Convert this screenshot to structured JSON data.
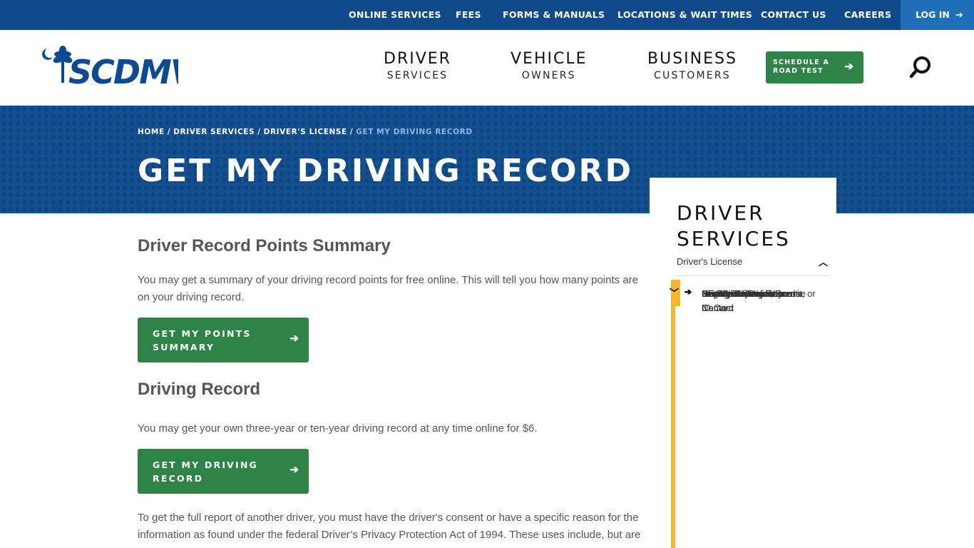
{
  "topbar": {
    "links": [
      "ONLINE SERVICES",
      "FEES",
      "FORMS & MANUALS",
      "LOCATIONS & WAIT TIMES",
      "CONTACT US",
      "CAREERS"
    ],
    "login_label": "LOG IN",
    "login_icon": "arrow-right-icon"
  },
  "header": {
    "logo_text": "SCDMV",
    "nav": [
      {
        "line1": "DRIVER",
        "line2": "SERVICES"
      },
      {
        "line1": "VEHICLE",
        "line2": "OWNERS"
      },
      {
        "line1": "BUSINESS",
        "line2": "CUSTOMERS"
      }
    ],
    "schedule_line1": "SCHEDULE A",
    "schedule_line2": "ROAD TEST",
    "search_icon": "search-icon"
  },
  "hero": {
    "breadcrumb": [
      "HOME",
      "DRIVER SERVICES",
      "DRIVER'S LICENSE",
      "GET MY DRIVING RECORD"
    ],
    "title": "GET MY DRIVING RECORD"
  },
  "main": {
    "section1_heading": "Driver Record Points Summary",
    "section1_text": "You may get a summary of your driving record points for free online. This will tell you how many points are on your driving record.",
    "button1_line1": "GET MY POINTS",
    "button1_line2": "SUMMARY",
    "section2_heading": "Driving Record",
    "section2_text": "You may get your own three-year or ten-year driving record at any time online for $6.",
    "button2_line1": "GET MY DRIVING",
    "button2_line2": "RECORD",
    "section3_text": "To get the full report of another driver, you must have the driver's consent or have a specific reason for the information as found under the federal Driver’s Privacy Protection Act of 1994. These uses include, but are"
  },
  "sidebar": {
    "title_line1": "DRIVER",
    "title_line2": "SERVICES",
    "parent": "Driver's License",
    "items": [
      {
        "label": "Beginner's Permit",
        "expandable": false
      },
      {
        "label": "Change My Address or Name",
        "expandable": false
      },
      {
        "label": "Driving Tests",
        "expandable": true
      },
      {
        "label": "First Driver's License",
        "expandable": false
      },
      {
        "label": "Get My Driving Record",
        "expandable": false,
        "active": true
      },
      {
        "label": "Insurance Requirements",
        "expandable": true
      },
      {
        "label": "Non-Commercial License",
        "expandable": false
      },
      {
        "label": "Provide Emergency Contact",
        "expandable": false
      },
      {
        "label": "REAL ID",
        "expandable": true
      },
      {
        "label": "Replace License, Permit, or ID Card",
        "expandable": false
      }
    ]
  },
  "colors": {
    "topbar": "#0f4a8a",
    "login": "#1f6fb8",
    "hero": "#12508f",
    "button_green": "#2e8447",
    "accent_yellow": "#f8b52d",
    "logo_blue": "#0d4a94"
  }
}
